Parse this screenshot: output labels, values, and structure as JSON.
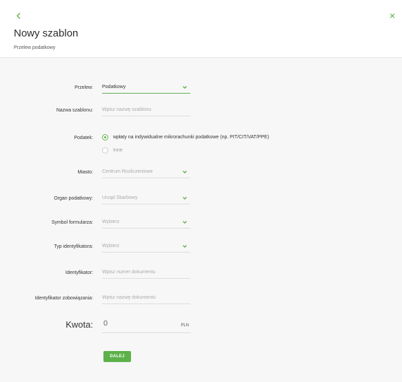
{
  "colors": {
    "accent": "#5db14a",
    "background": "#f7f7f7"
  },
  "header": {
    "back_icon": "chevron-left-icon",
    "close_icon": "close-icon",
    "title": "Nowy szablon",
    "subtitle": "Przelew podatkowy"
  },
  "form": {
    "przelew": {
      "label": "Przelew:",
      "value": "Podatkowy"
    },
    "nazwa": {
      "label": "Nazwa szablonu:",
      "placeholder": "Wpisz nazwę szablonu"
    },
    "podatek": {
      "label": "Podatek:",
      "options": [
        {
          "label": "wpłaty na indywidualne mikrorachunki podatkowe (np. PIT/CIT/VAT/PPE)",
          "checked": true
        },
        {
          "label": "Inne",
          "checked": false
        }
      ]
    },
    "miasto": {
      "label": "Miasto:",
      "value": "Centrum Rozliczeniowe"
    },
    "organ": {
      "label": "Organ podatkowy:",
      "value": "Urząd Skarbowy"
    },
    "symbol": {
      "label": "Symbol formularza:",
      "placeholder": "Wybierz"
    },
    "typ": {
      "label": "Typ identyfikatora:",
      "placeholder": "Wybierz"
    },
    "identyfikator": {
      "label": "Identyfikator:",
      "placeholder": "Wpisz numer dokumentu"
    },
    "zobowiazanie": {
      "label": "Identyfikator zobowiązania:",
      "placeholder": "Wpisz nazwę dokumentu"
    },
    "kwota": {
      "label": "Kwota:",
      "value": "0",
      "currency": "PLN"
    },
    "submit_label": "DALEJ"
  }
}
